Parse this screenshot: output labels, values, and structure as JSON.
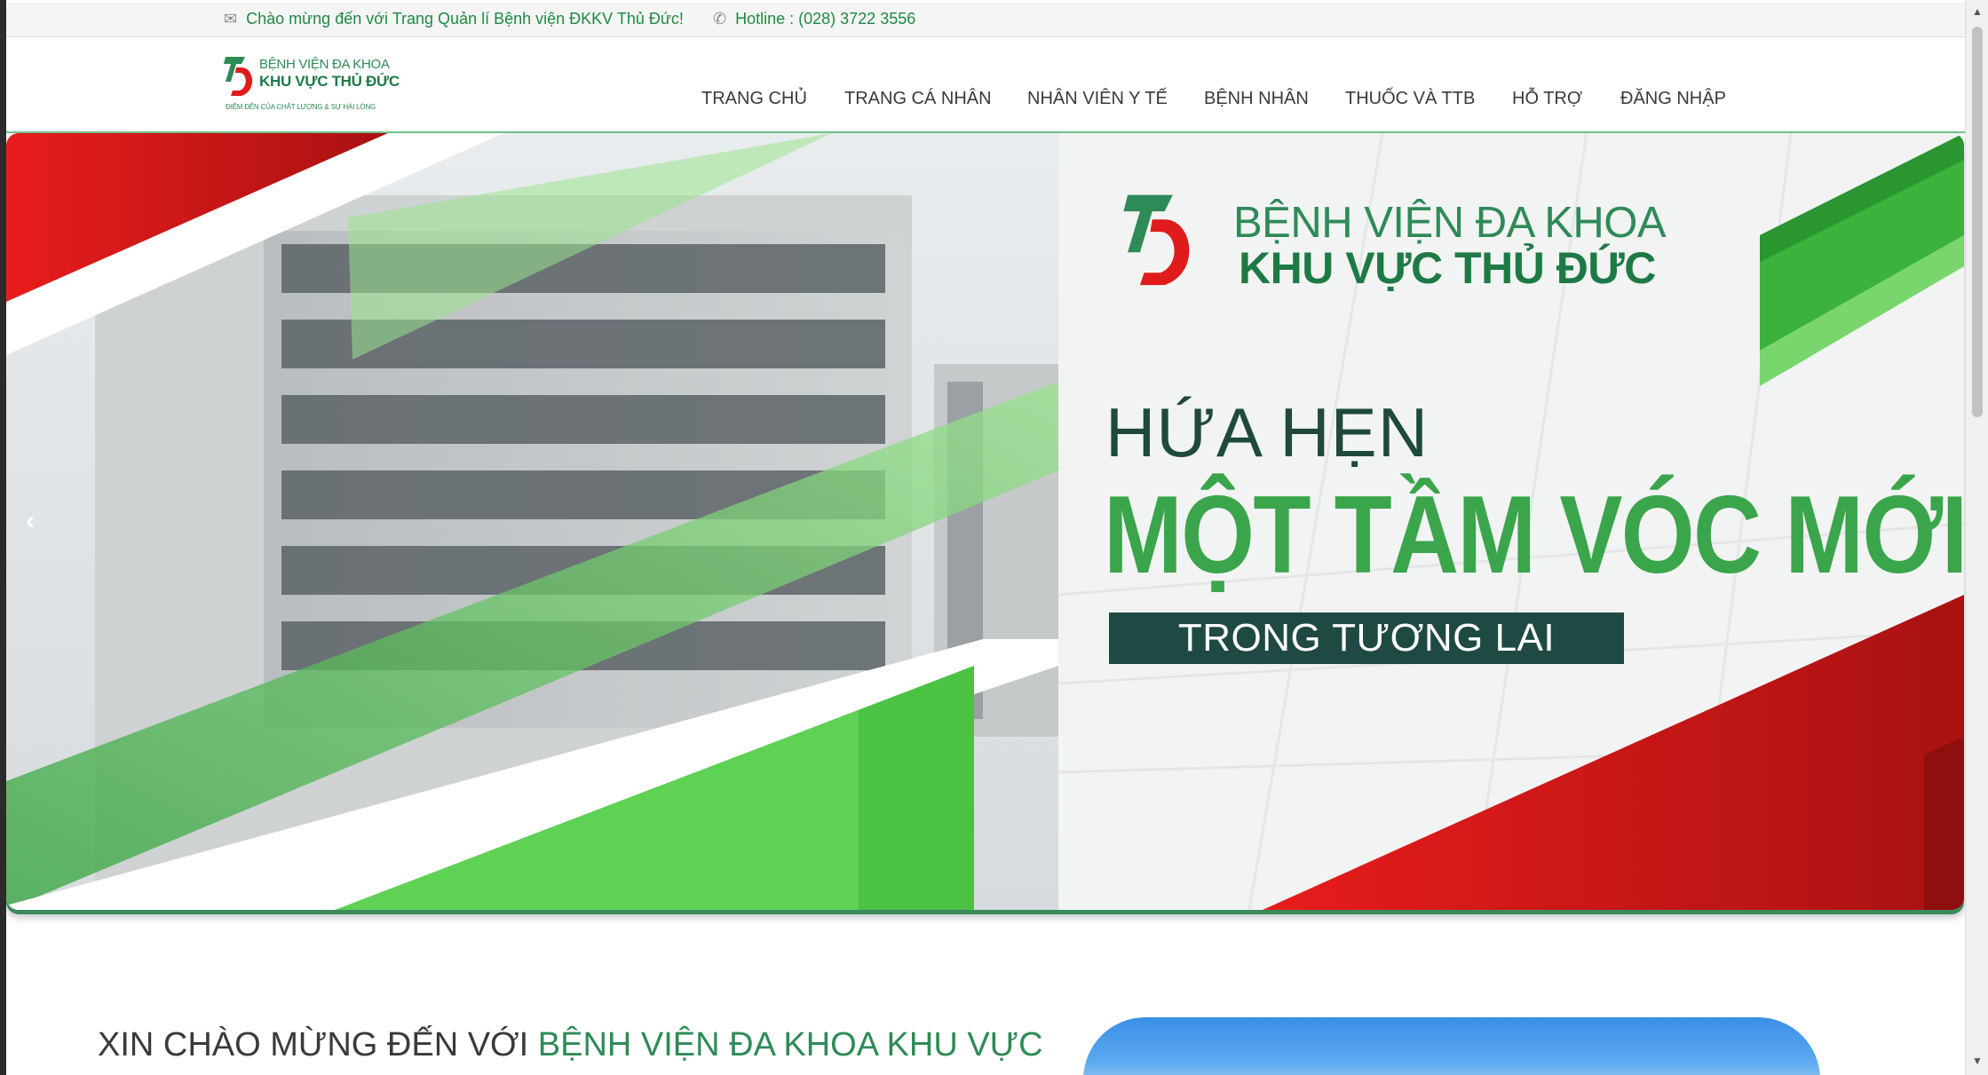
{
  "topbar": {
    "welcome_text": "Chào mừng đến với Trang Quản lí Bệnh viện ĐKKV Thủ Đức!",
    "welcome_icon": "envelope-icon",
    "hotline_text": "Hotline : (028) 3722 3556",
    "hotline_icon": "phone-icon"
  },
  "brand": {
    "line1": "BỆNH VIỆN ĐA KHOA",
    "line2": "KHU VỰC THỦ ĐỨC",
    "tagline": "ĐIỂM ĐẾN CỦA CHẤT LƯỢNG & SỰ HÀI LÒNG"
  },
  "nav": {
    "items": [
      {
        "label": "TRANG CHỦ"
      },
      {
        "label": "TRANG CÁ NHÂN"
      },
      {
        "label": "NHÂN VIÊN Y TẾ"
      },
      {
        "label": "BỆNH NHÂN"
      },
      {
        "label": "THUỐC VÀ TTB"
      },
      {
        "label": "HỖ TRỢ"
      },
      {
        "label": "ĐĂNG NHẬP"
      }
    ]
  },
  "hero": {
    "logo_line1": "BỆNH VIỆN ĐA KHOA",
    "logo_line2": "KHU VỰC THỦ ĐỨC",
    "promise": "HỨA HẸN",
    "headline": "MỘT TẦM VÓC MỚI",
    "subline": "TRONG TƯƠNG LAI",
    "prev_icon": "chevron-left-icon"
  },
  "welcome": {
    "prefix": "XIN CHÀO MỪNG ĐẾN VỚI ",
    "highlight": "BỆNH VIỆN ĐA KHOA KHU VỰC"
  },
  "colors": {
    "brand_green": "#2e8b57",
    "accent_red": "#e01b1b",
    "dark_teal": "#1f4a43"
  }
}
